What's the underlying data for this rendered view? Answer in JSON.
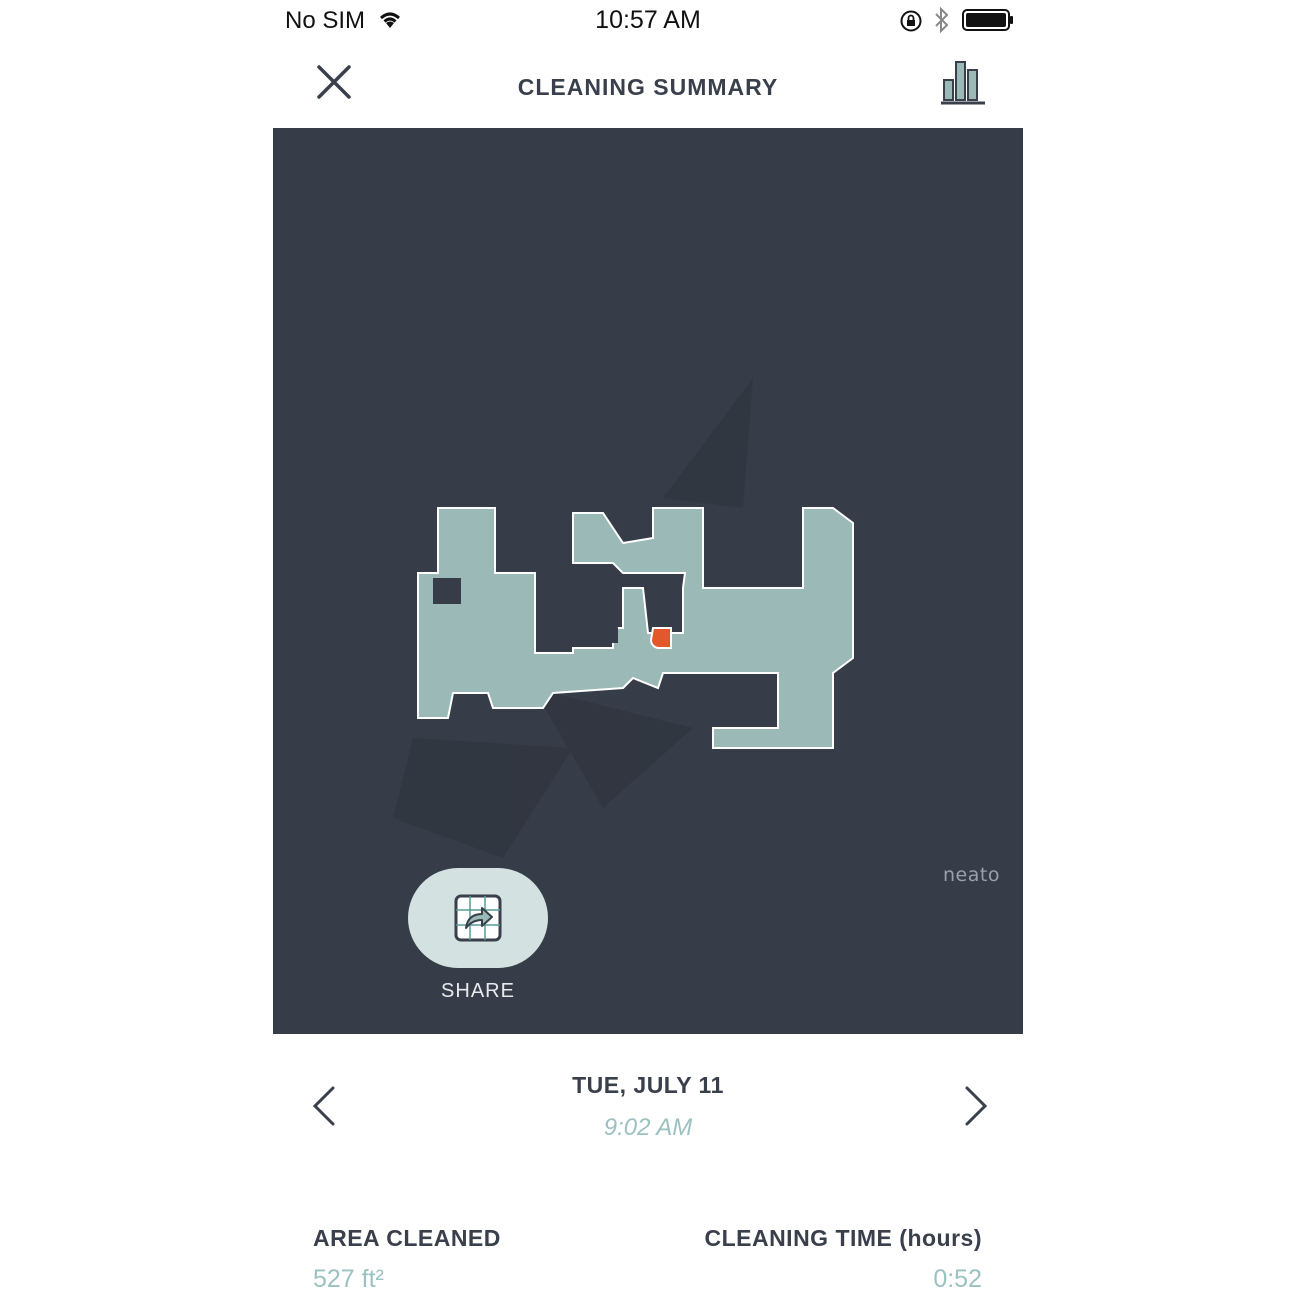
{
  "status_bar": {
    "carrier": "No SIM",
    "time": "10:57 AM",
    "icons": [
      "wifi-icon",
      "rotation-lock-icon",
      "bluetooth-icon",
      "battery-icon"
    ]
  },
  "header": {
    "title": "CLEANING SUMMARY",
    "close_icon": "close-icon",
    "stats_icon": "bar-chart-icon"
  },
  "map": {
    "brand": "neato",
    "share_label": "SHARE",
    "share_icon": "share-map-icon",
    "colors": {
      "background": "#373d48",
      "cleaned_area": "#9ab9b7",
      "robot": "#e2582b"
    }
  },
  "session": {
    "date": "TUE, JULY 11",
    "time": "9:02 AM",
    "prev_icon": "chevron-left-icon",
    "next_icon": "chevron-right-icon"
  },
  "stats": {
    "area_label": "AREA CLEANED",
    "area_value": "527 ft²",
    "time_label": "CLEANING TIME (hours)",
    "time_value": "0:52"
  }
}
